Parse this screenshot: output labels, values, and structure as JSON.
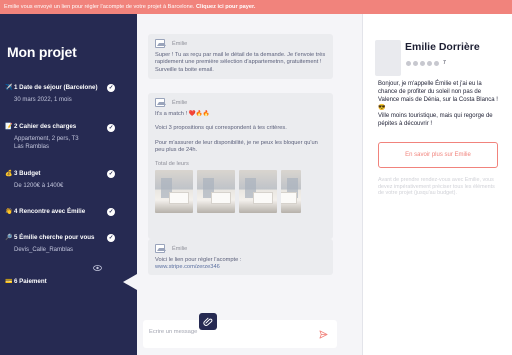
{
  "banner": {
    "text": "Emilie vous envoyé un lien pour régler l'acompte de votre projet à Barcelone.",
    "link": "Cliquez ici pour payer."
  },
  "sidebar": {
    "title": "Mon projet",
    "steps": [
      {
        "emoji": "✈️",
        "label": "1  Date de séjour (Barcelone)",
        "sub": "30 mars 2022, 1 mois",
        "done": true
      },
      {
        "emoji": "📝",
        "label": "2  Cahier des charges",
        "sub": "Appartement, 2 pers, T3\nLas Ramblas",
        "done": true
      },
      {
        "emoji": "💰",
        "label": "3  Budget",
        "sub": "De 1200€ à 1400€",
        "done": true
      },
      {
        "emoji": "👋",
        "label": "4  Rencontre avec Émilie",
        "sub": "",
        "done": true
      },
      {
        "emoji": "🔎",
        "label": "5  Émilie cherche pour vous",
        "sub": "Devis_Calle_Ramblas",
        "done": true
      },
      {
        "emoji": "💳",
        "label": "6  Paiement",
        "sub": "",
        "done": false
      }
    ],
    "check_glyph": "✓",
    "eye_icon": "eye-icon"
  },
  "chat": {
    "messages": [
      {
        "author": "Émilie",
        "text": "Super ! Tu as reçu par mail le détail de ta demande. Je t'envoie très rapidement une première sélection d'appartemetnn, gratuitement ! Surveille ta boite email."
      },
      {
        "author": "Émilie",
        "paragraphs": [
          "It's a match ! ❤️🔥🔥",
          "Voici 3 propositions qui correspondent à tes critères.",
          "Pour m'assurer de leur disponibilité, je ne peux les bloquer qu'un peu plus de 24h.",
          "Total de leurs"
        ]
      },
      {
        "author": "Émilie",
        "text": "Voici le lien pour régler l'acompte :",
        "link": "www.stripe.com/zerze346"
      }
    ],
    "composer_placeholder": "Ecrire un message"
  },
  "profile": {
    "name": "Emilie Dorrière",
    "rating_count": "7",
    "bio": "Bonjour, je m'appelle Émilie et j'ai eu la chance de profiter du soleil non pas de Valence mais de Dénia, sur la Costa Blanca ! 😎\nVille moins touristique, mais qui regorge de pépites à découvrir !",
    "more_button": "En savoir plus sur Emilie",
    "note": "Avant de prendre rendez-vous avec Emilie, vous devez impérativement préciser tous les éléments de votre projet (jusqu'au budget)."
  },
  "colors": {
    "banner": "#f1837c",
    "sidebar": "#262a52",
    "accent": "#f1837c"
  }
}
